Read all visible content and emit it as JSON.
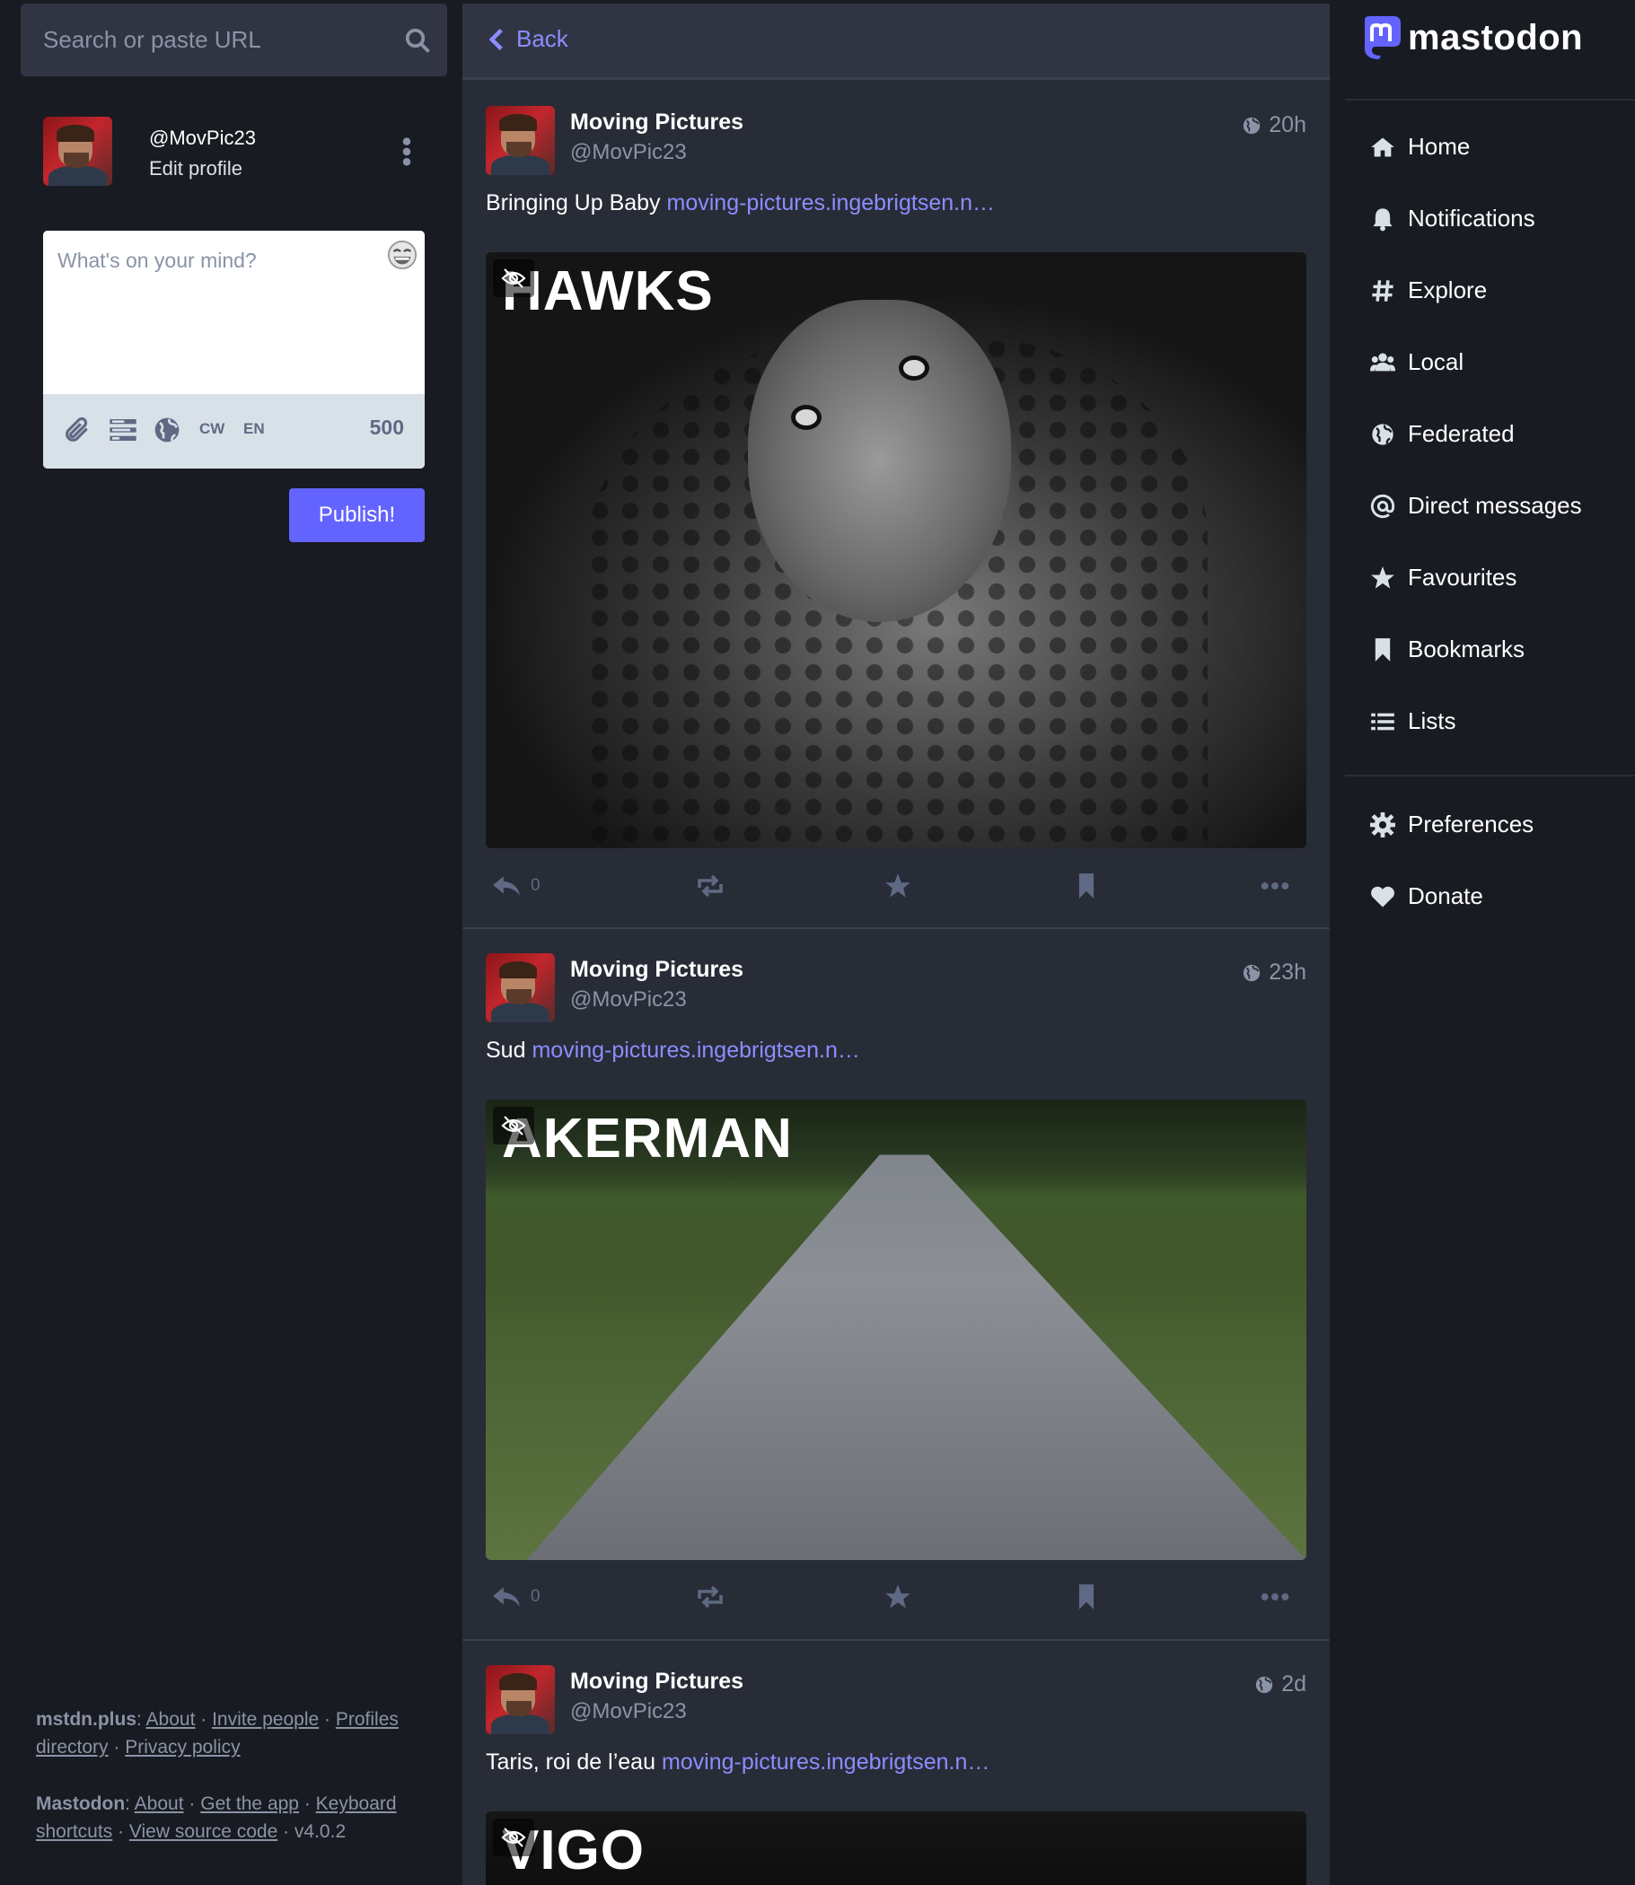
{
  "search": {
    "placeholder": "Search or paste URL"
  },
  "profile": {
    "acct": "@MovPic23",
    "edit_label": "Edit profile"
  },
  "composer": {
    "placeholder": "What's on your mind?",
    "cw_label": "CW",
    "lang_label": "EN",
    "char_count": "500",
    "publish_label": "Publish!"
  },
  "footer": {
    "server": "mstdn.plus",
    "server_links": [
      "About",
      "Invite people",
      "Profiles directory",
      "Privacy policy"
    ],
    "mastodon": "Mastodon",
    "mastodon_links": [
      "About",
      "Get the app",
      "Keyboard shortcuts",
      "View source code"
    ],
    "version": "v4.0.2"
  },
  "column": {
    "back_label": "Back"
  },
  "statuses": [
    {
      "display_name": "Moving Pictures",
      "handle": "@MovPic23",
      "time": "20h",
      "text": "Bringing Up Baby",
      "link": "moving-pictures.ingebrigtsen.n…",
      "media_title": "HAWKS",
      "reply_count": "0"
    },
    {
      "display_name": "Moving Pictures",
      "handle": "@MovPic23",
      "time": "23h",
      "text": "Sud",
      "link": "moving-pictures.ingebrigtsen.n…",
      "media_title": "AKERMAN",
      "reply_count": "0"
    },
    {
      "display_name": "Moving Pictures",
      "handle": "@MovPic23",
      "time": "2d",
      "text": "Taris, roi de l’eau",
      "link": "moving-pictures.ingebrigtsen.n…",
      "media_title": "VIGO"
    }
  ],
  "brand": {
    "name": "mastodon",
    "accent": "#6364ff",
    "link": "#8c8dff"
  },
  "nav": {
    "items": [
      {
        "label": "Home",
        "icon": "home-icon"
      },
      {
        "label": "Notifications",
        "icon": "bell-icon"
      },
      {
        "label": "Explore",
        "icon": "hashtag-icon"
      },
      {
        "label": "Local",
        "icon": "users-icon"
      },
      {
        "label": "Federated",
        "icon": "globe-icon"
      },
      {
        "label": "Direct messages",
        "icon": "at-icon"
      },
      {
        "label": "Favourites",
        "icon": "star-icon"
      },
      {
        "label": "Bookmarks",
        "icon": "bookmark-icon"
      },
      {
        "label": "Lists",
        "icon": "list-icon"
      }
    ],
    "secondary": [
      {
        "label": "Preferences",
        "icon": "gear-icon"
      },
      {
        "label": "Donate",
        "icon": "heart-icon"
      }
    ]
  }
}
